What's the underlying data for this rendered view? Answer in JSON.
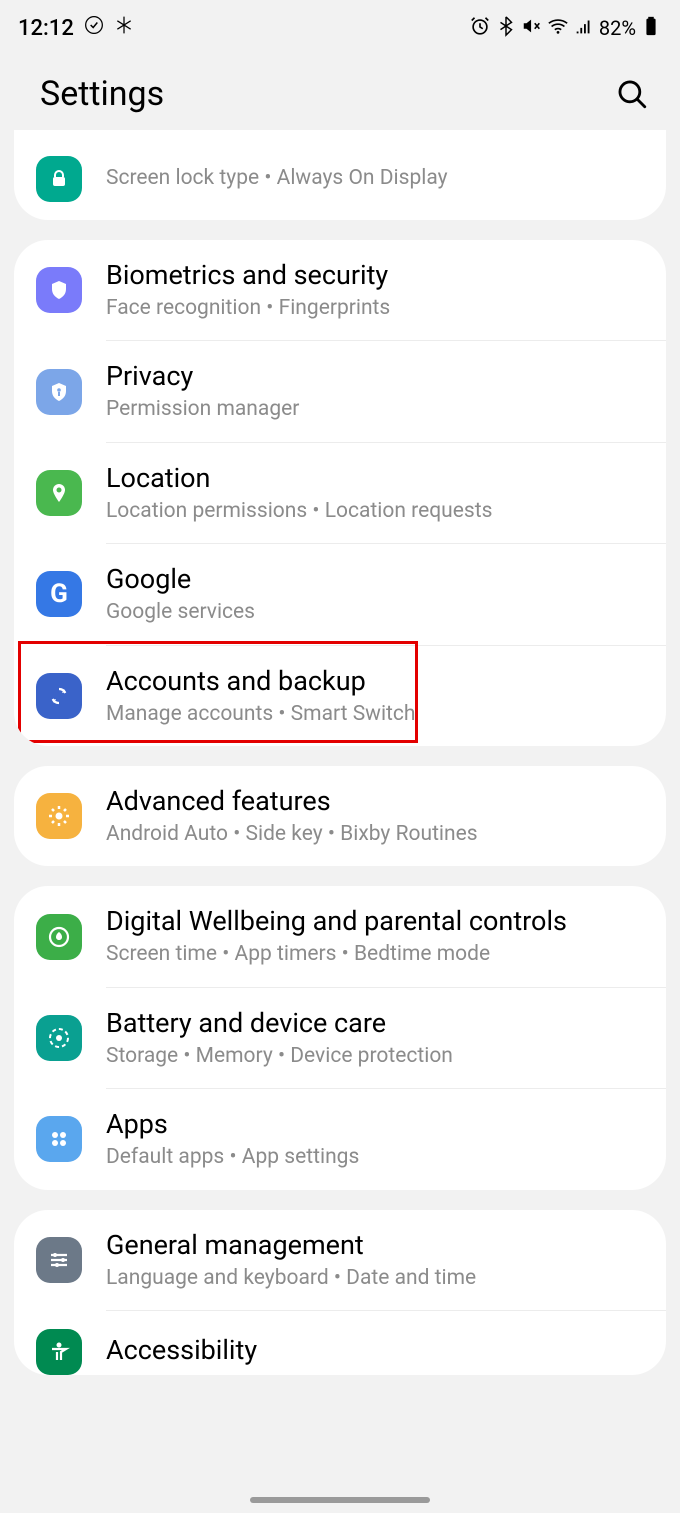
{
  "statusbar": {
    "time": "12:12",
    "battery": "82%"
  },
  "header": {
    "title": "Settings"
  },
  "groups": [
    {
      "partial_top": true,
      "items": [
        {
          "id": "lockscreen",
          "title": "",
          "subtitle": "Screen lock type  •  Always On Display",
          "icon": "lock",
          "icon_color": "#00a98f"
        }
      ]
    },
    {
      "items": [
        {
          "id": "biometrics",
          "title": "Biometrics and security",
          "subtitle": "Face recognition  •  Fingerprints",
          "icon": "shield",
          "icon_color": "#7a7bfa"
        },
        {
          "id": "privacy",
          "title": "Privacy",
          "subtitle": "Permission manager",
          "icon": "privacy",
          "icon_color": "#7ca6e8"
        },
        {
          "id": "location",
          "title": "Location",
          "subtitle": "Location permissions  •  Location requests",
          "icon": "pin",
          "icon_color": "#4ab84f"
        },
        {
          "id": "google",
          "title": "Google",
          "subtitle": "Google services",
          "icon": "g",
          "icon_color": "#3578e5"
        },
        {
          "id": "accounts-backup",
          "title": "Accounts and backup",
          "subtitle": "Manage accounts  •  Smart Switch",
          "icon": "sync",
          "icon_color": "#3a63c9",
          "highlighted": true
        }
      ]
    },
    {
      "items": [
        {
          "id": "advanced-features",
          "title": "Advanced features",
          "subtitle": "Android Auto  •  Side key  •  Bixby Routines",
          "icon": "gear",
          "icon_color": "#f6b23f"
        }
      ]
    },
    {
      "items": [
        {
          "id": "digital-wellbeing",
          "title": "Digital Wellbeing and parental controls",
          "subtitle": "Screen time  •  App timers  •  Bedtime mode",
          "icon": "wellbeing",
          "icon_color": "#3cae48"
        },
        {
          "id": "battery",
          "title": "Battery and device care",
          "subtitle": "Storage  •  Memory  •  Device protection",
          "icon": "battery-care",
          "icon_color": "#0aa091"
        },
        {
          "id": "apps",
          "title": "Apps",
          "subtitle": "Default apps  •  App settings",
          "icon": "apps",
          "icon_color": "#5aa7ee"
        }
      ]
    },
    {
      "items": [
        {
          "id": "general-management",
          "title": "General management",
          "subtitle": "Language and keyboard  •  Date and time",
          "icon": "sliders",
          "icon_color": "#6c7988"
        },
        {
          "id": "accessibility",
          "title": "Accessibility",
          "subtitle": "",
          "icon": "accessibility",
          "icon_color": "#008a51",
          "partial_bottom": true
        }
      ]
    }
  ]
}
